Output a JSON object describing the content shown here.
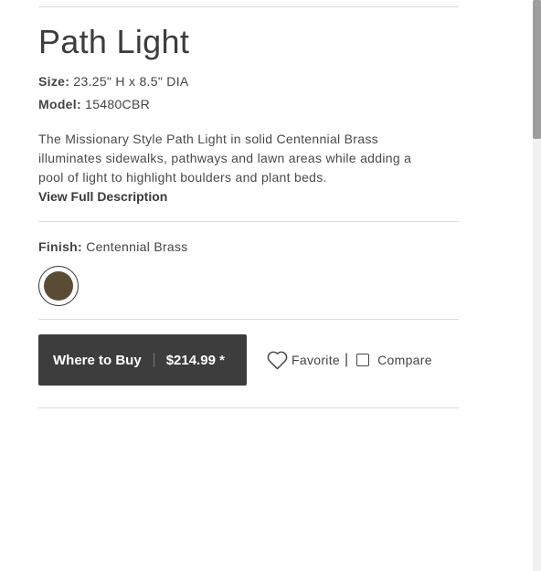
{
  "product": {
    "title": "Path Light",
    "size_label": "Size:",
    "size_value": "23.25\" H x 8.5\" DIA",
    "model_label": "Model:",
    "model_value": "15480CBR",
    "description_line1": "The Missionary Style Path Light in solid Centennial Brass",
    "description_line2": "illuminates sidewalks, pathways and lawn areas while adding a",
    "description_line3": "pool of light to highlight boulders and plant beds.",
    "view_full_label": "View Full Description"
  },
  "finish": {
    "label": "Finish:",
    "value": "Centennial Brass",
    "swatch_color": "#5a4c34"
  },
  "actions": {
    "where_to_buy_label": "Where to Buy",
    "price": "$214.99 *",
    "favorite_label": "Favorite",
    "favorite_icon": "heart-icon",
    "separator": "|",
    "compare_label": "Compare"
  },
  "colors": {
    "button_bg": "#3d3d3d",
    "text": "#3a3a3a",
    "divider": "#dcdcdc"
  }
}
